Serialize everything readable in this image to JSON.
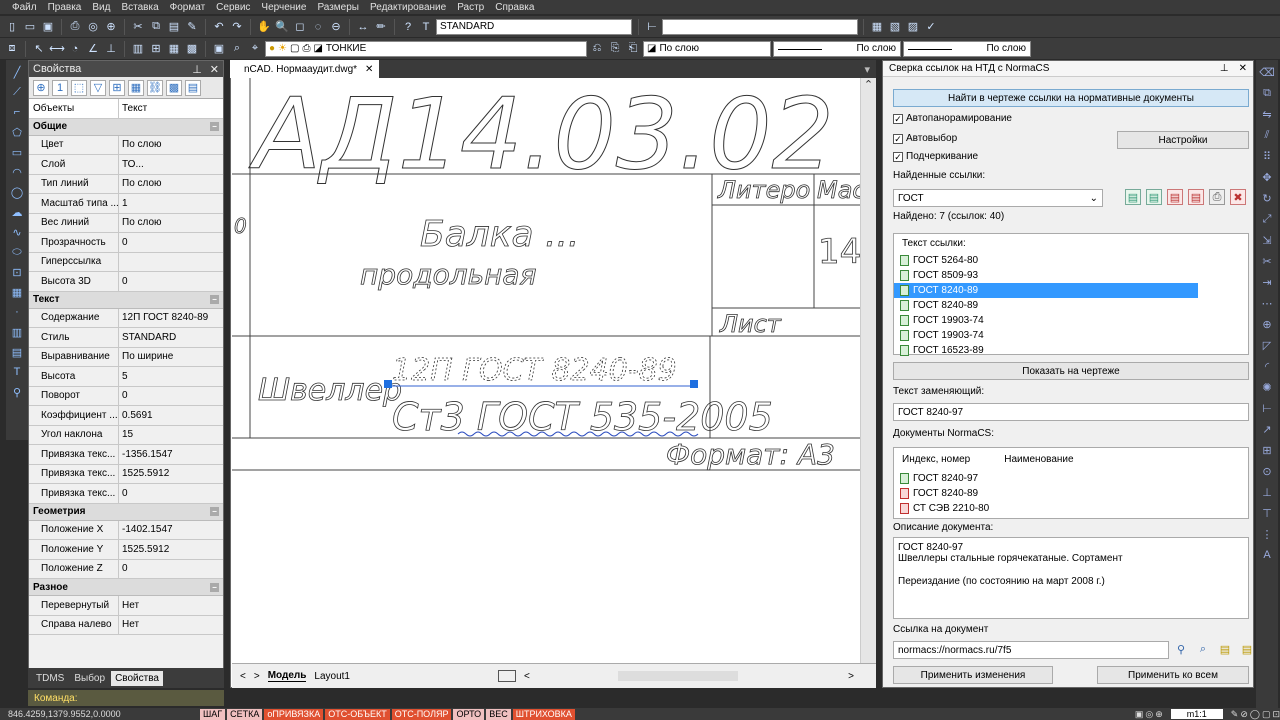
{
  "menu": [
    "Файл",
    "Правка",
    "Вид",
    "Вставка",
    "Формат",
    "Сервис",
    "Черчение",
    "Размеры",
    "Редактирование",
    "Растр",
    "Справка"
  ],
  "toolbar": {
    "text_style": "STANDARD",
    "layer_combo": "ТОНКИЕ",
    "color_combo": "По слою",
    "linetype1": "По слою",
    "linetype2": "По слою"
  },
  "props": {
    "title": "Свойства",
    "object_type_label": "Объекты",
    "object_type_value": "Текст",
    "sections": [
      {
        "name": "Общие",
        "rows": [
          [
            "Цвет",
            "По слою"
          ],
          [
            "Слой",
            "ТО..."
          ],
          [
            "Тип линий",
            "По слою"
          ],
          [
            "Масштаб типа ...",
            "1"
          ],
          [
            "Вес линий",
            "По слою"
          ],
          [
            "Прозрачность",
            "0"
          ],
          [
            "Гиперссылка",
            ""
          ],
          [
            "Высота 3D",
            "0"
          ]
        ]
      },
      {
        "name": "Текст",
        "rows": [
          [
            "Содержание",
            "12П  ГОСТ 8240-89"
          ],
          [
            "Стиль",
            "STANDARD"
          ],
          [
            "Выравнивание",
            "По ширине"
          ],
          [
            "Высота",
            "5"
          ],
          [
            "Поворот",
            "0"
          ],
          [
            "Коэффициент ...",
            "0.5691"
          ],
          [
            "Угол наклона",
            "15"
          ],
          [
            "Привязка текс...",
            "-1356.1547"
          ],
          [
            "Привязка текс...",
            "1525.5912"
          ],
          [
            "Привязка текс...",
            "0"
          ]
        ]
      },
      {
        "name": "Геометрия",
        "rows": [
          [
            "Положение X",
            "-1402.1547"
          ],
          [
            "Положение Y",
            "1525.5912"
          ],
          [
            "Положение Z",
            "0"
          ]
        ]
      },
      {
        "name": "Разное",
        "rows": [
          [
            "Перевернутый",
            "Нет"
          ],
          [
            "Справа налево",
            "Нет"
          ]
        ]
      }
    ],
    "tabs": [
      "TDMS",
      "Выбор",
      "Свойства"
    ]
  },
  "command_label": "Команда:",
  "doc_tab": "nCAD. Нормааудит.dwg*",
  "drawing": {
    "big": "АД14.03.02",
    "litera": "Литеро",
    "mass": "Мас",
    "num": "14,",
    "list": "Лист",
    "title1": "Балка ...",
    "title2": "продольная",
    "shveller": "Швеллер",
    "t1": "12П  ГОСТ 8240-89",
    "t2": "Ст3 ГОСТ 535-2005",
    "format": "Формат: А3",
    "zero": "0"
  },
  "layout_tabs": [
    "Модель",
    "Layout1"
  ],
  "status": {
    "coords": "846.4259,1379.9552,0.0000",
    "buttons": [
      "ШАГ",
      "СЕТКА",
      "оПРИВЯЗКА",
      "ОТС-ОБЪЕКТ",
      "ОТС-ПОЛЯР",
      "ОРТО",
      "ВЕС",
      "ШТРИХОВКА"
    ],
    "scale": "m1:1"
  },
  "norma": {
    "title": "Сверка ссылок на НТД с NormaCS",
    "find_btn": "Найти в чертеже ссылки на нормативные документы",
    "auto_pan": "Автопанорамирование",
    "auto_sel": "Автовыбор",
    "underline": "Подчеркивание",
    "settings_btn": "Настройки",
    "found_refs_label": "Найденные ссылки:",
    "found_combo": "ГОСТ",
    "found_count": "Найдено: 7 (ссылок: 40)",
    "ref_text_label": "Текст ссылки:",
    "refs": [
      "ГОСТ 5264-80",
      "ГОСТ 8509-93",
      "ГОСТ 8240-89",
      "ГОСТ 8240-89",
      "ГОСТ 19903-74",
      "ГОСТ 19903-74",
      "ГОСТ 16523-89"
    ],
    "show_btn": "Показать на чертеже",
    "replace_label": "Текст заменяющий:",
    "replace_value": "ГОСТ 8240-97",
    "docs_label": "Документы NormaCS:",
    "docs_col1": "Индекс, номер",
    "docs_col2": "Наименование",
    "docs": [
      "ГОСТ 8240-97",
      "ГОСТ 8240-89",
      "СТ СЭВ 2210-80"
    ],
    "desc_label": "Описание документа:",
    "desc1": "ГОСТ 8240-97",
    "desc2": "Швеллеры стальные горячекатаные. Сортамент",
    "desc3": "Переиздание (по состоянию на март 2008 г.)",
    "link_label": "Ссылка на документ",
    "link_value": "normacs://normacs.ru/7f5",
    "apply_btn": "Применить изменения",
    "apply_all_btn": "Применить ко всем"
  }
}
